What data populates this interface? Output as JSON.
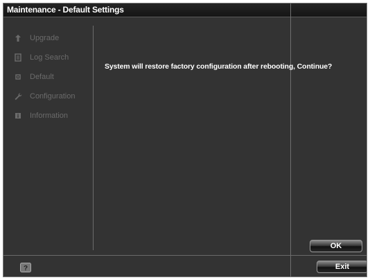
{
  "window": {
    "title": "Maintenance - Default Settings"
  },
  "sidebar": {
    "items": [
      {
        "label": "Upgrade",
        "icon": "upload-arrow-icon"
      },
      {
        "label": "Log Search",
        "icon": "document-icon"
      },
      {
        "label": "Default",
        "icon": "default-icon"
      },
      {
        "label": "Configuration",
        "icon": "wrench-icon"
      },
      {
        "label": "Information",
        "icon": "info-icon"
      }
    ]
  },
  "dialog": {
    "message": "System will restore factory configuration after rebooting, Continue?"
  },
  "buttons": {
    "ok": "OK",
    "exit": "Exit"
  },
  "footer": {
    "help_icon": "help-icon"
  },
  "colors": {
    "window_bg": "#333333",
    "title_bg": "#1c1c1c",
    "sidebar_text": "#6b6b6b",
    "message_text": "#ffffff"
  }
}
